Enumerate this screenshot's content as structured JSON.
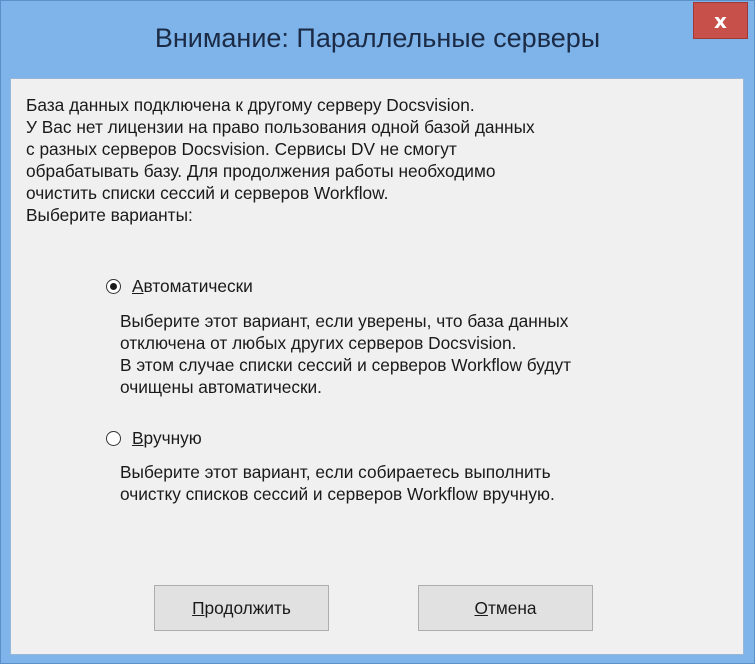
{
  "dialog": {
    "title": "Внимание: Параллельные серверы",
    "close_label": "x"
  },
  "message": {
    "lines": [
      "База данных подключена к другому серверу Docsvision.",
      "У Вас нет лицензии на право пользования одной базой данных",
      "с разных серверов Docsvision. Сервисы DV не смогут",
      "обрабатывать базу. Для продолжения работы необходимо",
      "очистить списки сессий и серверов Workflow.",
      "Выберите варианты:"
    ]
  },
  "options": [
    {
      "label_prefix": "А",
      "label_rest": "втоматически",
      "checked": true,
      "description": [
        "Выберите этот вариант, если уверены, что база данных",
        "отключена от любых других серверов Docsvision.",
        "В этом случае списки сессий и серверов Workflow будут",
        "очищены автоматически."
      ]
    },
    {
      "label_prefix": "В",
      "label_rest": "ручную",
      "checked": false,
      "description": [
        "Выберите этот вариант, если собираетесь выполнить",
        "очистку списков сессий и серверов Workflow  вручную."
      ]
    }
  ],
  "buttons": {
    "continue_prefix": "П",
    "continue_rest": "родолжить",
    "cancel_prefix": "О",
    "cancel_rest": "тмена"
  },
  "colors": {
    "frame": "#7eb4ea",
    "close": "#c7504a",
    "client": "#f0f0f0"
  }
}
